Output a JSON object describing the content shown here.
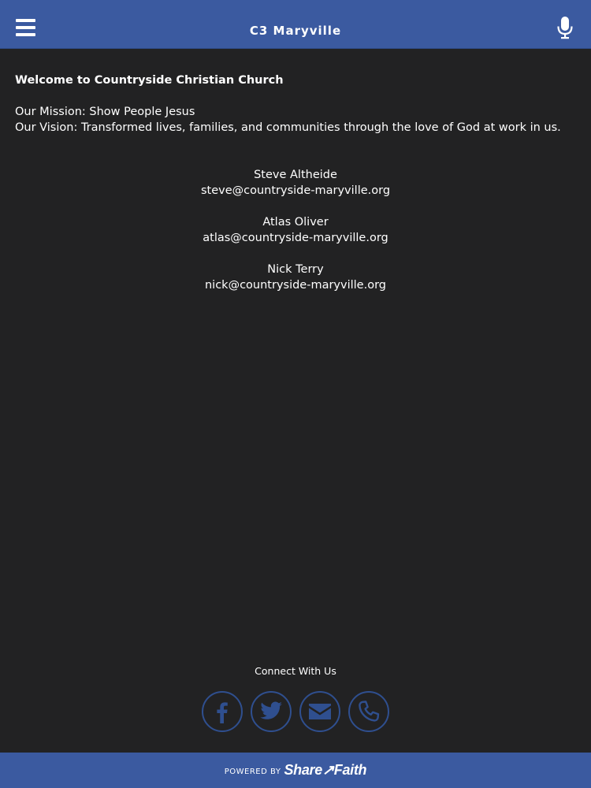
{
  "header": {
    "title": "C3 Maryville",
    "menu_icon": "hamburger-menu-icon",
    "mic_icon": "microphone-icon"
  },
  "main": {
    "welcome": "Welcome to Countryside Christian Church",
    "mission": "Our Mission: Show People Jesus",
    "vision": "Our Vision: Transformed lives, families, and communities through the love of God at work in us.",
    "contacts": [
      {
        "name": "Steve Altheide",
        "email": "steve@countryside-maryville.org"
      },
      {
        "name": "Atlas Oliver",
        "email": "atlas@countryside-maryville.org"
      },
      {
        "name": "Nick Terry",
        "email": "nick@countryside-maryville.org"
      }
    ]
  },
  "connect": {
    "label": "Connect With Us",
    "icons": [
      "facebook-icon",
      "twitter-icon",
      "email-icon",
      "phone-icon"
    ]
  },
  "footer": {
    "powered_by": "POWERED BY",
    "brand": "Share↗Faith"
  },
  "colors": {
    "header_bg": "#3b5aa0",
    "page_bg": "#222223",
    "social_ring": "#2f4f8f",
    "text": "#ffffff"
  }
}
